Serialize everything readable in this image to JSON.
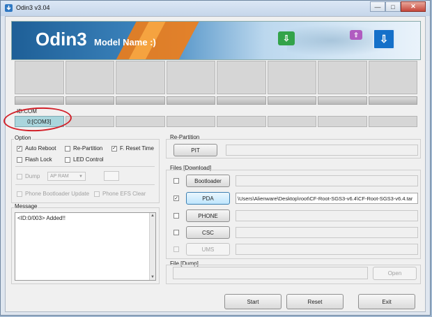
{
  "window": {
    "title": "Odin3 v3.04",
    "minimize": "—",
    "maximize": "□",
    "close": "✕"
  },
  "banner": {
    "title": "Odin3",
    "subtitle": "Model Name :)",
    "icons": [
      "download-icon",
      "upload-icon",
      "download-icon"
    ]
  },
  "slots": {
    "count": 8
  },
  "id_com": {
    "label": "ID:COM",
    "ports": [
      "0:[COM3]",
      "",
      "",
      "",
      "",
      "",
      "",
      ""
    ]
  },
  "option": {
    "label": "Option",
    "auto_reboot": {
      "label": "Auto Reboot",
      "checked": true
    },
    "re_partition": {
      "label": "Re-Partition",
      "checked": false
    },
    "f_reset_time": {
      "label": "F. Reset Time",
      "checked": true
    },
    "flash_lock": {
      "label": "Flash Lock",
      "checked": false
    },
    "led_control": {
      "label": "LED Control",
      "checked": false
    },
    "dump": {
      "label": "Dump",
      "checked": false
    },
    "dump_select": "AP RAM",
    "phone_bootloader_update": {
      "label": "Phone Bootloader Update",
      "checked": false
    },
    "phone_efs_clear": {
      "label": "Phone EFS Clear",
      "checked": false
    }
  },
  "message": {
    "label": "Message",
    "text": "<ID:0/003> Added!!"
  },
  "re_partition": {
    "label": "Re-Partition",
    "pit_button": "PIT",
    "pit_path": ""
  },
  "files": {
    "label": "Files [Download]",
    "rows": [
      {
        "button": "Bootloader",
        "checked": false,
        "path": ""
      },
      {
        "button": "PDA",
        "checked": true,
        "path": "\\Users\\Alienware\\Desktop\\root\\CF-Root-SGS3-v6.4\\CF-Root-SGS3-v6.4.tar"
      },
      {
        "button": "PHONE",
        "checked": false,
        "path": ""
      },
      {
        "button": "CSC",
        "checked": false,
        "path": ""
      },
      {
        "button": "UMS",
        "checked": false,
        "path": ""
      }
    ]
  },
  "file_dump": {
    "label": "File [Dump]",
    "path": "",
    "open_button": "Open"
  },
  "actions": {
    "start": "Start",
    "reset": "Reset",
    "exit": "Exit"
  },
  "colors": {
    "highlight_oval": "#d2212a",
    "active_com": "#a9d5dc",
    "banner_orange": "#f07d18",
    "banner_blue": "#1e5f97"
  }
}
